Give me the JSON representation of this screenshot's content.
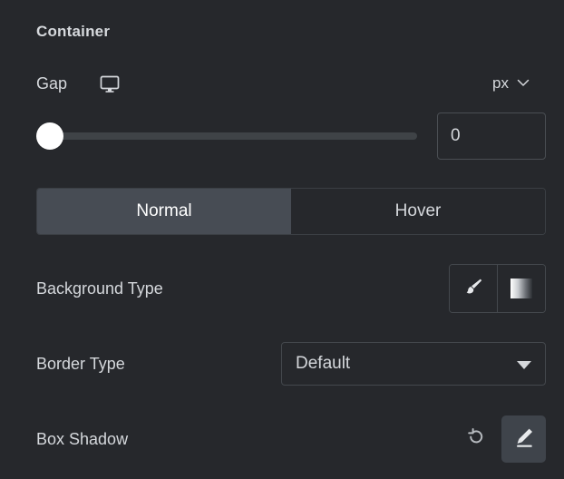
{
  "panel": {
    "section_title": "Container",
    "gap": {
      "label": "Gap",
      "device_icon": "desktop-monitor-icon",
      "unit": "px",
      "unit_caret_icon": "chevron-down-icon",
      "value": "0",
      "slider_position_percent": 0
    },
    "state_tabs": {
      "items": [
        {
          "label": "Normal",
          "active": true
        },
        {
          "label": "Hover",
          "active": false
        }
      ]
    },
    "background_type": {
      "label": "Background Type",
      "options": [
        {
          "name": "classic",
          "icon": "paint-brush-icon"
        },
        {
          "name": "gradient",
          "icon": "gradient-swatch-icon"
        }
      ]
    },
    "border_type": {
      "label": "Border Type",
      "value": "Default",
      "caret_icon": "caret-down-icon"
    },
    "box_shadow": {
      "label": "Box Shadow",
      "reset_icon": "reset-undo-icon",
      "edit_icon": "pencil-edit-icon"
    }
  },
  "colors": {
    "background": "#26282c",
    "text": "#d5d8dc",
    "tab_active": "#474c54",
    "slider_thumb": "#ffffff",
    "slider_track": "#3f4347",
    "border": "#44484d",
    "edit_button": "#3f444b"
  }
}
